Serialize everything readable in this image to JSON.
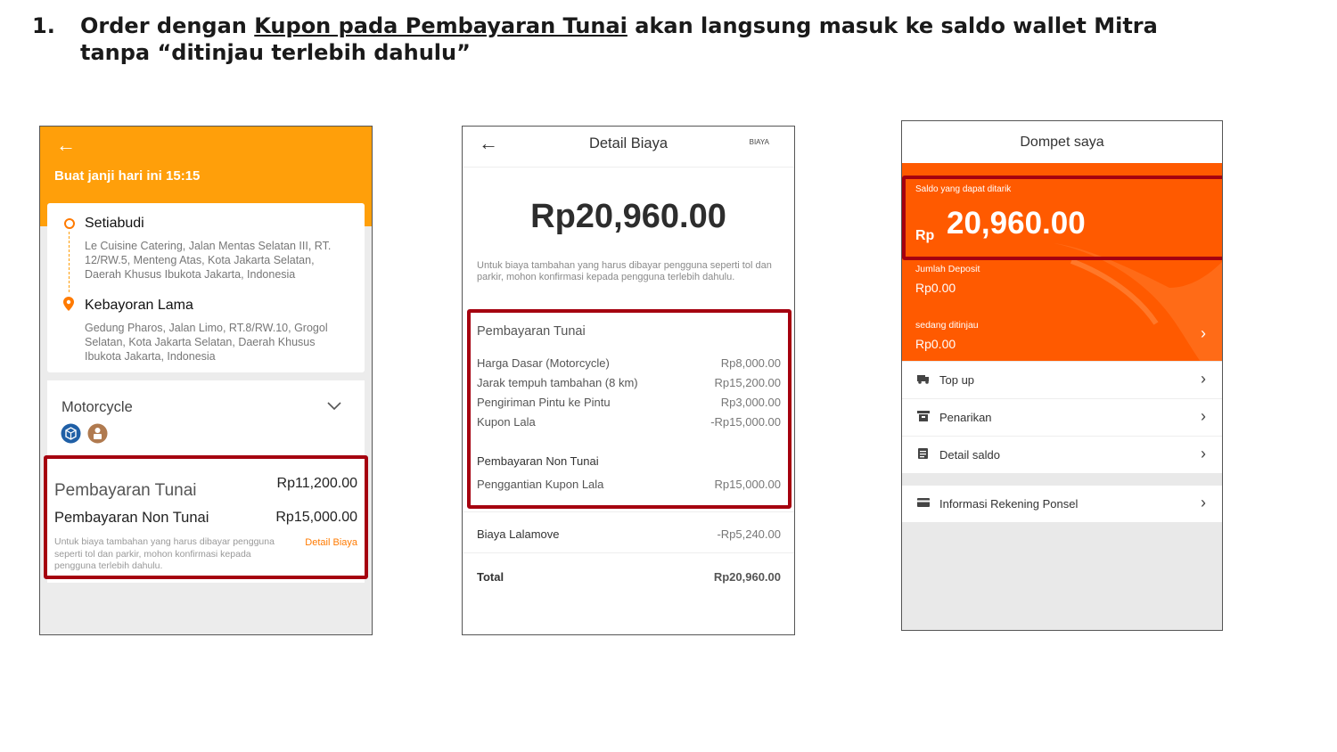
{
  "heading": {
    "number": "1.",
    "text_before": "Order dengan ",
    "text_underlined": "Kupon pada Pembayaran Tunai",
    "text_after": " akan langsung masuk ke saldo wallet Mitra tanpa “ditinjau terlebih dahulu”"
  },
  "colors": {
    "orange": "#ff9f0a",
    "wallet_orange": "#ff5a00",
    "highlight_red": "#a5000f"
  },
  "order_screen": {
    "back_icon": "arrow-left-icon",
    "schedule": "Buat janji hari ini 15:15",
    "pickup": {
      "name": "Setiabudi",
      "address": "Le Cuisine Catering, Jalan Mentas Selatan III, RT. 12/RW.5, Menteng Atas, Kota Jakarta Selatan, Daerah Khusus Ibukota Jakarta, Indonesia"
    },
    "dropoff": {
      "name": "Kebayoran Lama",
      "address": "Gedung Pharos, Jalan Limo, RT.8/RW.10, Grogol Selatan, Kota Jakarta Selatan, Daerah Khusus Ibukota Jakarta, Indonesia"
    },
    "vehicle": "Motorcycle",
    "cash_label": "Pembayaran Tunai",
    "cash_amount": "Rp11,200.00",
    "noncash_label": "Pembayaran Non Tunai",
    "noncash_amount": "Rp15,000.00",
    "note": "Untuk biaya tambahan yang harus dibayar pengguna seperti tol dan parkir, mohon konfirmasi kepada pengguna terlebih dahulu.",
    "detail_link": "Detail Biaya"
  },
  "detail_screen": {
    "title": "Detail Biaya",
    "tag": "BIAYA",
    "total_big": "Rp20,960.00",
    "note": "Untuk biaya tambahan yang harus dibayar pengguna seperti tol dan parkir, mohon konfirmasi kepada pengguna terlebih dahulu.",
    "cash_section": "Pembayaran Tunai",
    "items": [
      {
        "label": "Harga Dasar (Motorcycle)",
        "value": "Rp8,000.00"
      },
      {
        "label": "Jarak tempuh tambahan (8 km)",
        "value": "Rp15,200.00"
      },
      {
        "label": "Pengiriman Pintu ke Pintu",
        "value": "Rp3,000.00"
      },
      {
        "label": "Kupon Lala",
        "value": "-Rp15,000.00"
      }
    ],
    "noncash_section": "Pembayaran Non Tunai",
    "noncash_item": {
      "label": "Penggantian Kupon Lala",
      "value": "Rp15,000.00"
    },
    "fee": {
      "label": "Biaya Lalamove",
      "value": "-Rp5,240.00"
    },
    "total": {
      "label": "Total",
      "value": "Rp20,960.00"
    }
  },
  "wallet_screen": {
    "title": "Dompet saya",
    "withdrawable_label": "Saldo yang dapat ditarik",
    "currency": "Rp",
    "withdrawable_amount": "20,960.00",
    "deposit_label": "Jumlah Deposit",
    "deposit_amount": "Rp0.00",
    "review_label": "sedang ditinjau",
    "review_amount": "Rp0.00",
    "menu": [
      {
        "label": "Top up",
        "icon": "truck-icon"
      },
      {
        "label": "Penarikan",
        "icon": "withdraw-icon"
      },
      {
        "label": "Detail saldo",
        "icon": "document-icon"
      }
    ],
    "menu_extra": {
      "label": "Informasi Rekening Ponsel",
      "icon": "card-icon"
    }
  }
}
